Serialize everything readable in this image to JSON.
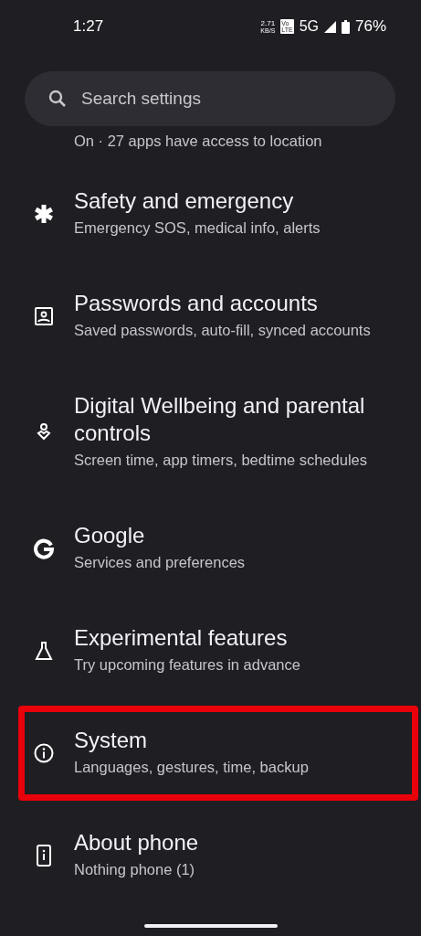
{
  "status_bar": {
    "time": "1:27",
    "speed_value": "2.71",
    "speed_unit": "KB/S",
    "volte_top": "Vo",
    "volte_bottom": "LTE",
    "network": "5G",
    "battery": "76%"
  },
  "search": {
    "placeholder": "Search settings"
  },
  "partial_summary": "On · 27 apps have access to location",
  "items": [
    {
      "kind": "asterisk",
      "title": "Safety and emergency",
      "summary": "Emergency SOS, medical info, alerts",
      "highlighted": false
    },
    {
      "kind": "account",
      "title": "Passwords and accounts",
      "summary": "Saved passwords, auto-fill, synced accounts",
      "highlighted": false
    },
    {
      "kind": "wellbeing",
      "title": "Digital Wellbeing and parental controls",
      "summary": "Screen time, app timers, bedtime schedules",
      "highlighted": false
    },
    {
      "kind": "google",
      "title": "Google",
      "summary": "Services and preferences",
      "highlighted": false
    },
    {
      "kind": "experimental",
      "title": "Experimental features",
      "summary": "Try upcoming features in advance",
      "highlighted": false
    },
    {
      "kind": "system",
      "title": "System",
      "summary": "Languages, gestures, time, backup",
      "highlighted": true
    },
    {
      "kind": "about",
      "title": "About phone",
      "summary": "Nothing phone (1)",
      "highlighted": false
    }
  ]
}
